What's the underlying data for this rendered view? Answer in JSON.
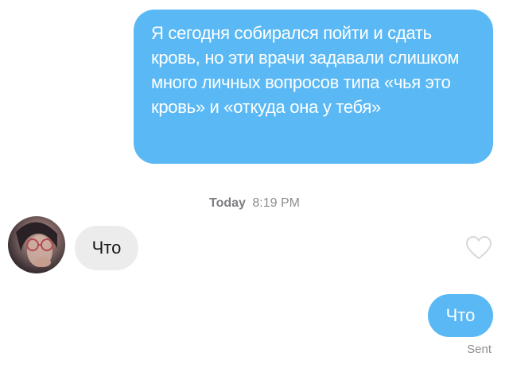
{
  "messages": {
    "outgoing_long": "Я сегодня собирался пойти и сдать кровь, но эти врачи задавали слишком много личных вопросов типа «чья это кровь» и «откуда она у тебя»",
    "incoming": "Что",
    "outgoing_short": "Что"
  },
  "timestamp": {
    "day": "Today",
    "time": "8:19 PM"
  },
  "status": "Sent",
  "colors": {
    "outgoing_bubble": "#5ab9f5",
    "incoming_bubble": "#ececec"
  },
  "icons": {
    "avatar": "user-avatar",
    "like": "heart-icon"
  }
}
